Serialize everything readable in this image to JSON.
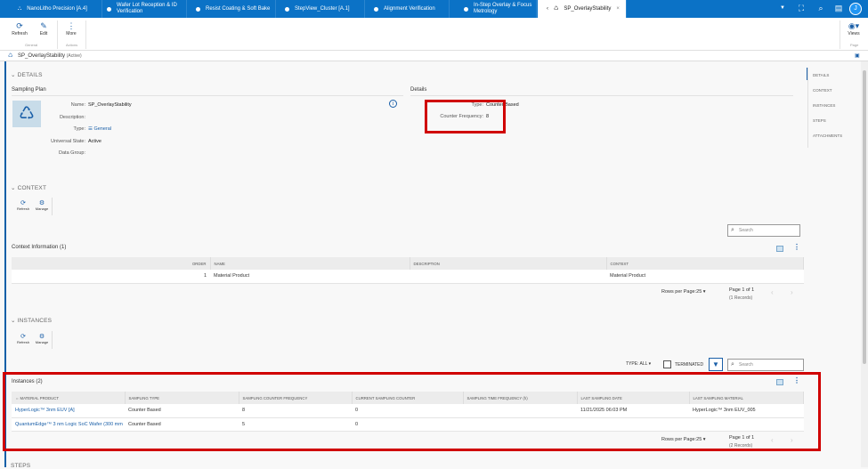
{
  "tabs": [
    {
      "label": "NanoLitho Precision [A.4]",
      "icon": "sitemap-icon"
    },
    {
      "label": "Wafer Lot Reception & ID Verification",
      "icon": "dot-icon"
    },
    {
      "label": "Resist Coating & Soft Bake",
      "icon": "dot-icon"
    },
    {
      "label": "StepView_Cluster [A.1]",
      "icon": "dot-icon"
    },
    {
      "label": "Alignment Verification",
      "icon": "dot-icon"
    },
    {
      "label": "In-Step Overlay & Focus Metrology",
      "icon": "dot-icon"
    },
    {
      "label": "SP_OverlayStability",
      "icon": "sampling-icon",
      "active": true
    }
  ],
  "header": {
    "avatar": "J"
  },
  "toolbar": {
    "refresh": "Refresh",
    "edit": "Edit",
    "more": "More",
    "general": "General",
    "actions": "Actions",
    "views": "Views",
    "page": "Page"
  },
  "title": {
    "name": "SP_OverlayStability",
    "state": "(Active)"
  },
  "details": {
    "section": "DETAILS",
    "sampling_plan": "Sampling Plan",
    "details_title": "Details",
    "fields": [
      {
        "label": "Name:",
        "value": "SP_OverlayStability"
      },
      {
        "label": "Description:",
        "value": ""
      },
      {
        "label": "Type:",
        "value": "General"
      },
      {
        "label": "Universal State:",
        "value": "Active"
      },
      {
        "label": "Data Group:",
        "value": ""
      }
    ],
    "type_label": "Type:",
    "type_value": "Counter Based",
    "counter_label": "Counter Frequency:",
    "counter_value": "8"
  },
  "context": {
    "section": "CONTEXT",
    "refresh": "Refresh",
    "manage": "Manage",
    "search_placeholder": "Search",
    "title": "Context Information (1)",
    "columns": [
      "ORDER",
      "NAME",
      "DESCRIPTION",
      "CONTEXT"
    ],
    "rows": [
      [
        "1",
        "Material Product",
        "",
        "Material Product"
      ]
    ],
    "rows_per_page": "Rows per Page:25",
    "page": "Page 1 of 1",
    "records": "(1 Records)"
  },
  "instances": {
    "section": "INSTANCES",
    "refresh": "Refresh",
    "manage": "Manage",
    "type_filter": "TYPE: ALL",
    "terminated": "TERMINATED",
    "search_placeholder": "Search",
    "title": "Instances (2)",
    "columns": [
      "MATERIAL PRODUCT",
      "SAMPLING TYPE",
      "SAMPLING COUNTER FREQUENCY",
      "CURRENT SAMPLING COUNTER",
      "SAMPLING TIME FREQUENCY (h)",
      "LAST SAMPLING DATE",
      "LAST SAMPLING MATERIAL"
    ],
    "rows": [
      [
        "HyperLogic™ 3nm EUV [A]",
        "Counter Based",
        "8",
        "0",
        "",
        "11/21/2025 06:03 PM",
        "HyperLogic™ 3nm EUV_005"
      ],
      [
        "QuantumEdge™ 3 nm Logic SoC Wafer (300 mm",
        "Counter Based",
        "5",
        "0",
        "",
        "",
        ""
      ]
    ],
    "rows_per_page": "Rows per Page:25",
    "page": "Page 1 of 1",
    "records": "(2 Records)"
  },
  "steps": {
    "section": "STEPS"
  },
  "right_nav": [
    "DETAILS",
    "CONTEXT",
    "INSTANCES",
    "STEPS",
    "ATTACHMENTS"
  ],
  "colors": {
    "brand": "#0b72c6",
    "highlight": "#d00000"
  }
}
